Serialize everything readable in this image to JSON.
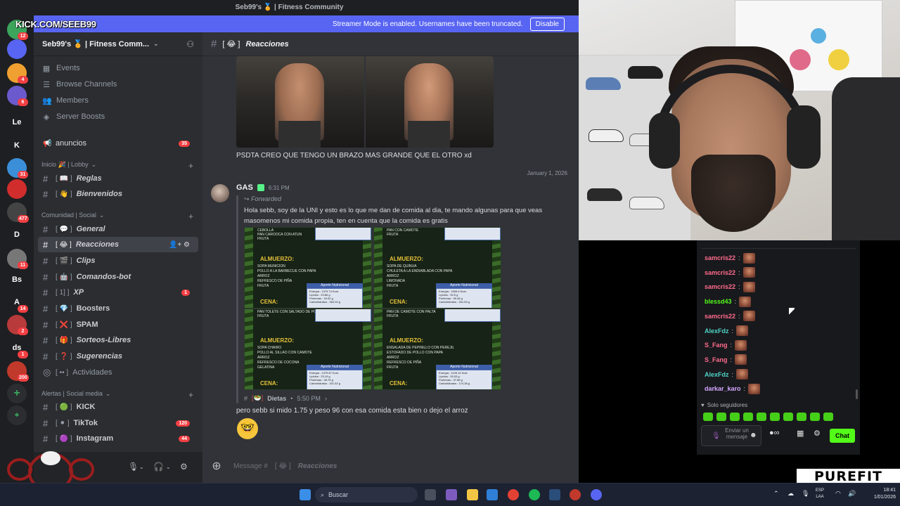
{
  "discord": {
    "window_title": "Seb99's 🏅 | Fitness Community",
    "banner_text": "Streamer Mode is enabled. Usernames have been truncated.",
    "banner_button": "Disable",
    "server_name": "Seb99's 🏅 | Fitness Comm...",
    "nav": [
      "Events",
      "Browse Channels",
      "Members",
      "Server Boosts"
    ],
    "announcements": {
      "label": "anuncios",
      "badge": "35"
    },
    "categories": [
      {
        "label": "Inicio 🎉 | Lobby"
      },
      {
        "label": "Comunidad | Social"
      },
      {
        "label": "Alertas | Social media"
      }
    ],
    "channels": [
      {
        "emoji": "📖",
        "label": "Reglas"
      },
      {
        "emoji": "👋",
        "label": "Bienvenidos"
      },
      {
        "emoji": "💬",
        "label": "General"
      },
      {
        "emoji": "😂",
        "label": "Reacciones"
      },
      {
        "emoji": "🎬",
        "label": "Clips"
      },
      {
        "emoji": "🤖",
        "label": "Comandos-bot"
      },
      {
        "emoji": "1]",
        "label": "XP",
        "badge": "1"
      },
      {
        "emoji": "💎",
        "label": "Boosters"
      },
      {
        "emoji": "❌",
        "label": "SPAM"
      },
      {
        "emoji": "🎁",
        "label": "Sorteos-Libres"
      },
      {
        "emoji": "❓",
        "label": "Sugerencias"
      },
      {
        "emoji": "••",
        "label": "Actividades"
      },
      {
        "emoji": "🟢",
        "label": "KICK"
      },
      {
        "emoji": "⚫",
        "label": "TikTok",
        "badge": "120"
      },
      {
        "emoji": "🟣",
        "label": "Instagram",
        "badge": "44"
      }
    ],
    "chat": {
      "channel_title": "Reacciones",
      "channel_emoji": "😂",
      "msg1_text": "PSDTA CREO QUE TENGO UN BRAZO MAS GRANDE QUE EL OTRO xd",
      "date_divider": "January 1, 2026",
      "msg2_author": "GAS",
      "msg2_time": "6:31 PM",
      "forwarded_label": "Forwarded",
      "msg2_text": "Hola sebb, soy de la UNI y esto es lo que me dan de comida al dia, te mando algunas para que veas masomenos mi comida propia, ten en cuenta que la comida es gratis",
      "ref_channel": "Dietas",
      "ref_time": "5:50 PM",
      "msg3_text": "pero sebb si mido 1.75 y peso 96 con esa comida esta bien o dejo el arroz",
      "emoji_reply": "🤓",
      "composer_placeholder": "Message #",
      "composer_channel": "Reacciones"
    },
    "diet_cards": [
      {
        "lines": [
          "CEBOLLA",
          "PAN CAROOCA CON ATUN",
          "FRUTA"
        ],
        "meal": "ALMUERZO:",
        "items": [
          "SOPA MUNICION",
          "POLLO A LA BARBECUE CON PAPA",
          "ARROZ",
          "REFRESCO DE PIÑA",
          "FRUTA"
        ],
        "dinner": "CENA:",
        "nutrition": [
          "Energía : 1379.74 Kcal.",
          "Lípidos : 23.86 g",
          "Proteínas : 43.52 g",
          "Carbohidratos : 262.04 g"
        ]
      },
      {
        "lines": [
          "PAN CON CAMOTE",
          "FRUTA"
        ],
        "meal": "ALMUERZO:",
        "items": [
          "SOPA DE QUINUA",
          "CHULETA A LA ENDIABLADA CON PAPA",
          "ARROZ",
          "LIMONADA",
          "FRUTA"
        ],
        "dinner": "CENA:",
        "nutrition": [
          "Energía : 1506.6 Kcal.",
          "Lípidos : 32.5 g",
          "Proteínas : 35.48 g",
          "Carbohidratos : 261.83 g"
        ]
      },
      {
        "lines": [
          "PAN TOLETE CON SALTADO DE POLLO",
          "FRUTA"
        ],
        "meal": "ALMUERZO:",
        "items": [
          "SOPA CHAIRO",
          "POLLO AL SILLAO CON CAMOTE",
          "ARROZ",
          "REFRESCO DE COCONA",
          "GELATINA"
        ],
        "dinner": "CENA:",
        "nutrition": [
          "Energía : 1379.87 Kcal.",
          "Lípidos : 23.19 g",
          "Proteínas : 48.75 g",
          "Carbohidratos : 201.52 g"
        ]
      },
      {
        "lines": [
          "PAN DE CAMOTE CON PALTA",
          "FRUTA"
        ],
        "meal": "ALMUERZO:",
        "items": [
          "ENSALADA DE PEPINILLO CON PEREJIL",
          "ESTOFADO DE POLLO CON PAPA",
          "ARROZ",
          "REFRESCO DE PIÑA",
          "FRUTA"
        ],
        "dinner": "CENA:",
        "nutrition": [
          "Energía : 1145.14 Kcal.",
          "Lípidos : 26.53 g",
          "Proteínas : 37.88 g",
          "Carbohidratos : 174.38 g"
        ]
      }
    ],
    "nutrition_title": "Aporte Nutricional",
    "guild_rail": [
      {
        "label": "",
        "badge": "12",
        "color": "#3ba55c"
      },
      {
        "label": "",
        "badge": "",
        "color": "#5865f2"
      },
      {
        "label": "",
        "badge": "4",
        "color": "#f0a030"
      },
      {
        "label": "",
        "badge": "6",
        "color": "#6a5acd"
      },
      {
        "label": "Le",
        "badge": "",
        "color": "#1e1f22"
      },
      {
        "label": "K",
        "badge": "",
        "color": "#1e1f22"
      },
      {
        "label": "",
        "badge": "31",
        "color": "#3a8fd8"
      },
      {
        "label": "",
        "badge": "",
        "color": "#d12d2d"
      },
      {
        "label": "",
        "badge": "477",
        "color": "#444"
      },
      {
        "label": "D",
        "badge": "",
        "color": "#1e1f22"
      },
      {
        "label": "",
        "badge": "11",
        "color": "#777"
      },
      {
        "label": "Bs",
        "badge": "",
        "color": "#1e1f22"
      },
      {
        "label": "A",
        "badge": "14",
        "color": "#1e1f22"
      },
      {
        "label": "",
        "badge": "2",
        "color": "#b83a3a"
      },
      {
        "label": "ds",
        "badge": "1",
        "color": "#1e1f22"
      },
      {
        "label": "",
        "badge": "200",
        "color": "#c0392b"
      }
    ]
  },
  "overlay": {
    "kick_url": "KICK.COM/SEEB99",
    "brand": "PUREFIT"
  },
  "kick_chat": {
    "messages": [
      {
        "user": "samcris22",
        "color": "#ff6b8b"
      },
      {
        "user": "samcris22",
        "color": "#ff6b8b"
      },
      {
        "user": "samcris22",
        "color": "#ff6b8b"
      },
      {
        "user": "blessd43",
        "color": "#53fc18"
      },
      {
        "user": "samcris22",
        "color": "#ff6b8b"
      },
      {
        "user": "AlexFdz",
        "color": "#4fd1c5"
      },
      {
        "user": "S_Fang",
        "color": "#ff6b8b"
      },
      {
        "user": "S_Fang",
        "color": "#ff6b8b"
      },
      {
        "user": "AlexFdz",
        "color": "#4fd1c5"
      },
      {
        "user": "darkar_karo",
        "color": "#d3a8ff"
      }
    ],
    "followers_only": "Solo seguidores",
    "input_placeholder": "Enviar un mensaje",
    "chat_button": "Chat"
  },
  "taskbar": {
    "search_placeholder": "Buscar",
    "lang_top": "ESP",
    "lang_bottom": "LAA",
    "time": "18:41",
    "date": "1/01/2026"
  }
}
